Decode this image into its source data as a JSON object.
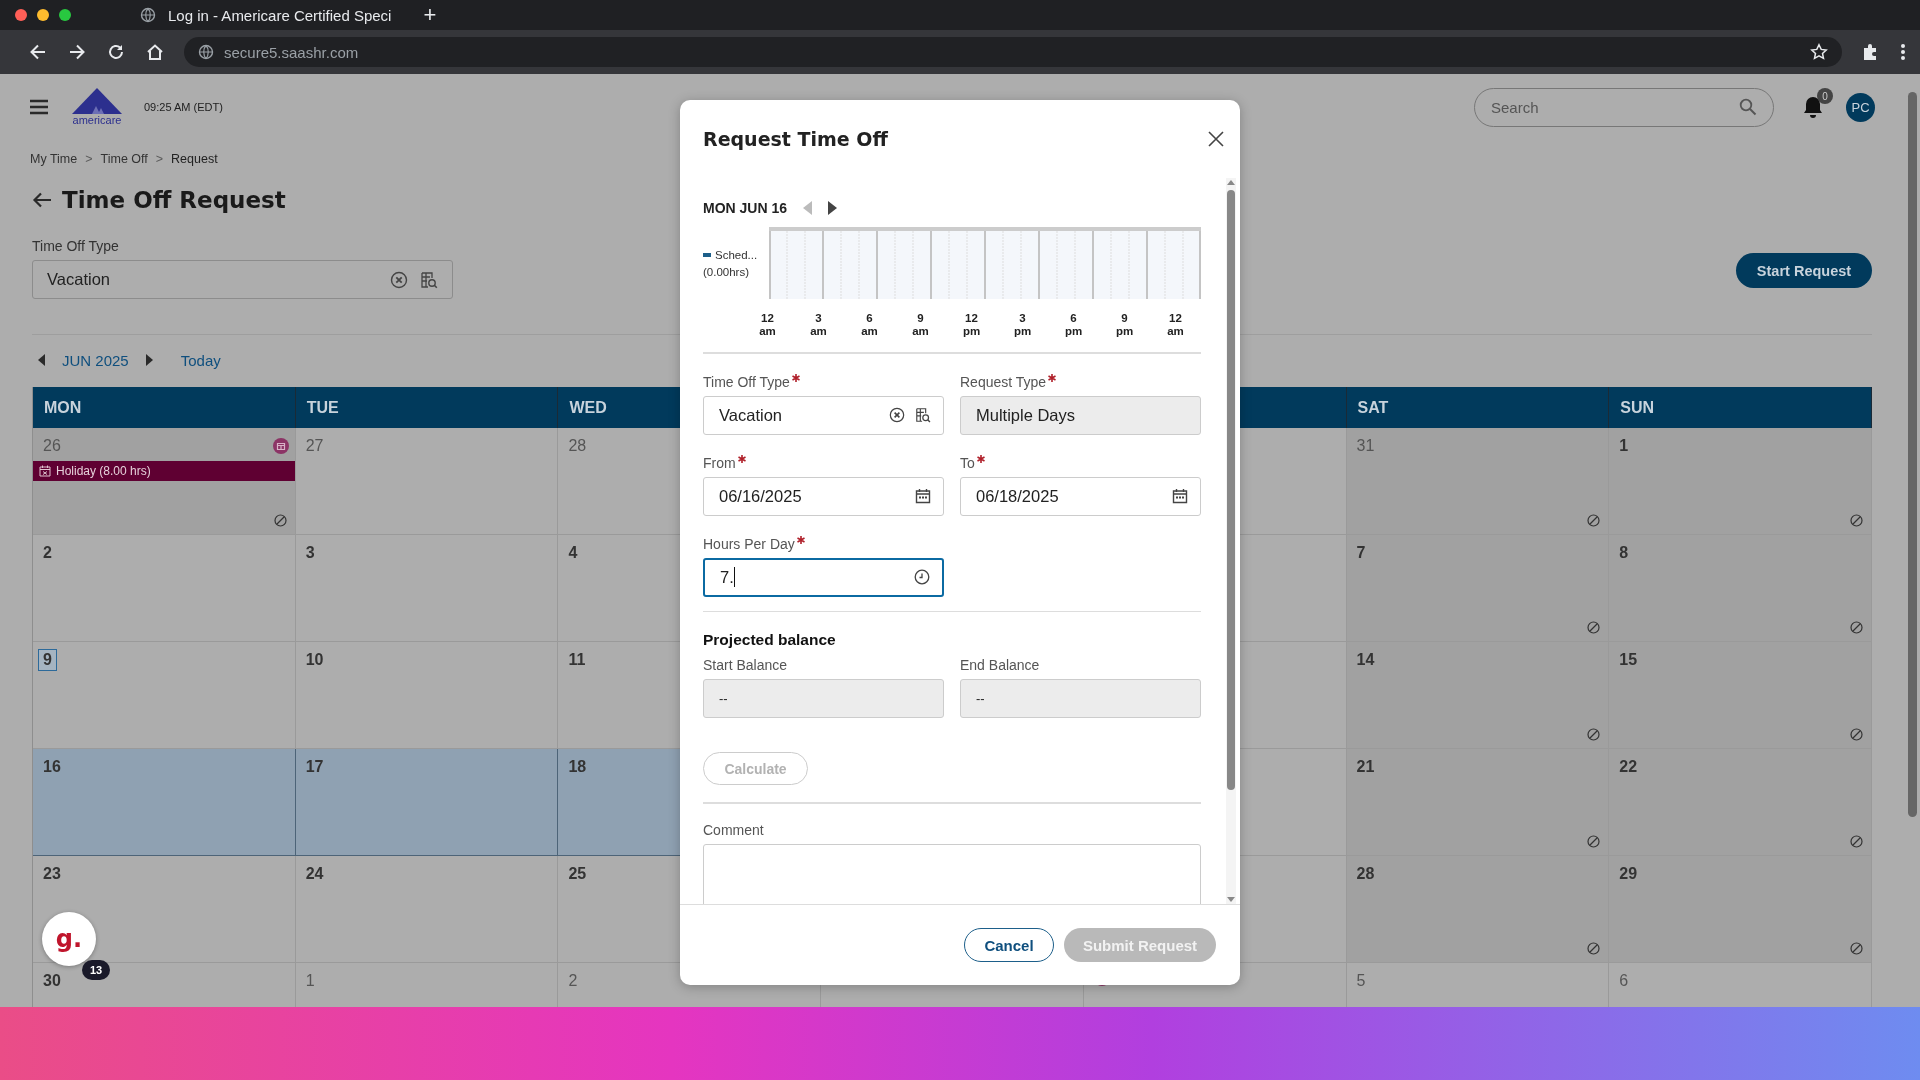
{
  "browser": {
    "tab_title": "Log in - Americare Certified Speci",
    "new_tab": "+",
    "url": "secure5.saashr.com"
  },
  "header": {
    "logo_text": "americare",
    "time": "09:25 AM (EDT)",
    "search": {
      "placeholder": "Search"
    },
    "notifications": "0",
    "avatar": "PC"
  },
  "breadcrumb": [
    {
      "kind": "link",
      "text": "My Time"
    },
    {
      "kind": "separator",
      "text": ">"
    },
    {
      "kind": "link",
      "text": "Time Off"
    },
    {
      "kind": "separator",
      "text": ">"
    },
    {
      "kind": "current",
      "text": "Request"
    }
  ],
  "page": {
    "title": "Time Off Request",
    "time_off_type": {
      "label": "Time Off Type",
      "value": "Vacation"
    },
    "start_button": "Start Request"
  },
  "calendar": {
    "month": "JUN 2025",
    "today_button": "Today",
    "columns": [
      "MON",
      "TUE",
      "WED",
      null,
      {},
      "SAT",
      "SUN"
    ],
    "weeks": [
      {
        "cells": [
          {
            "day": "26",
            "muted": true,
            "off": true,
            "holiday": true,
            "event": "Holiday (8.00 hrs)"
          },
          {
            "day": "27",
            "muted": true
          },
          {
            "day": "28",
            "muted": true
          },
          null,
          {},
          {
            "day": "31",
            "muted": true,
            "off": true
          },
          {
            "day": "1",
            "off": true
          }
        ]
      },
      {
        "cells": [
          {
            "day": "2"
          },
          {
            "day": "3"
          },
          {
            "day": "4"
          },
          null,
          {},
          {
            "day": "7",
            "off": true
          },
          {
            "day": "8",
            "off": true
          }
        ]
      },
      {
        "cells": [
          {
            "day": "9",
            "today": true
          },
          {
            "day": "10"
          },
          {
            "day": "11"
          },
          null,
          {},
          {
            "day": "14",
            "off": true
          },
          {
            "day": "15",
            "off": true
          }
        ]
      },
      {
        "cells": [
          {
            "day": "16",
            "selected": true
          },
          {
            "day": "17",
            "selected": true
          },
          {
            "day": "18",
            "selected": true
          },
          null,
          {},
          {
            "day": "21",
            "off": true
          },
          {
            "day": "22",
            "off": true
          }
        ]
      },
      {
        "cells": [
          {
            "day": "23"
          },
          {
            "day": "24"
          },
          {
            "day": "25"
          },
          null,
          {},
          {
            "day": "28",
            "off": true
          },
          {
            "day": "29",
            "off": true
          }
        ]
      },
      {
        "cells": [
          {
            "day": "30"
          },
          {
            "day": "1",
            "muted": true
          },
          {
            "day": "2",
            "muted": true
          },
          null,
          {
            "holiday": true
          },
          {
            "day": "5",
            "muted": true
          },
          {
            "day": "6",
            "muted": true
          }
        ]
      }
    ]
  },
  "dialog": {
    "title": "Request Time Off",
    "date": "MON JUN 16",
    "timeline": {
      "legend": "Sched...",
      "hours": "(0.00hrs)",
      "ticks": [
        {
          "hour": "12",
          "period": "am"
        },
        {
          "hour": "3",
          "period": "am"
        },
        {
          "hour": "6",
          "period": "am"
        },
        {
          "hour": "9",
          "period": "am"
        },
        {
          "hour": "12",
          "period": "pm"
        },
        {
          "hour": "3",
          "period": "pm"
        },
        {
          "hour": "6",
          "period": "pm"
        },
        {
          "hour": "9",
          "period": "pm"
        },
        {
          "hour": "12",
          "period": "am"
        }
      ]
    },
    "fields": [
      {
        "label": "Time Off Type",
        "required": true,
        "value": "Vacation",
        "kind": "lookup",
        "focused": false
      },
      {
        "label": "Request Type",
        "required": true,
        "value": "Multiple Days",
        "kind": "readonly",
        "focused": false
      },
      {
        "label": "From",
        "required": true,
        "value": "06/16/2025",
        "kind": "date",
        "focused": false
      },
      {
        "label": "To",
        "required": true,
        "value": "06/18/2025",
        "kind": "date",
        "focused": false
      },
      {
        "label": "Hours Per Day",
        "required": true,
        "value": "7.",
        "kind": "time",
        "focused": true
      }
    ],
    "balance": {
      "heading": "Projected balance",
      "start": {
        "label": "Start Balance",
        "value": "--"
      },
      "end": {
        "label": "End Balance",
        "value": "--"
      }
    },
    "calculate": {
      "label": "Calculate",
      "disabled": true
    },
    "comment": {
      "label": "Comment"
    },
    "buttons": [
      {
        "label": "Cancel",
        "kind": "secondary",
        "disabled": false
      },
      {
        "label": "Submit Request",
        "kind": "primary",
        "disabled": true
      }
    ]
  },
  "assistant": {
    "logo": "g.",
    "badge": "13"
  }
}
